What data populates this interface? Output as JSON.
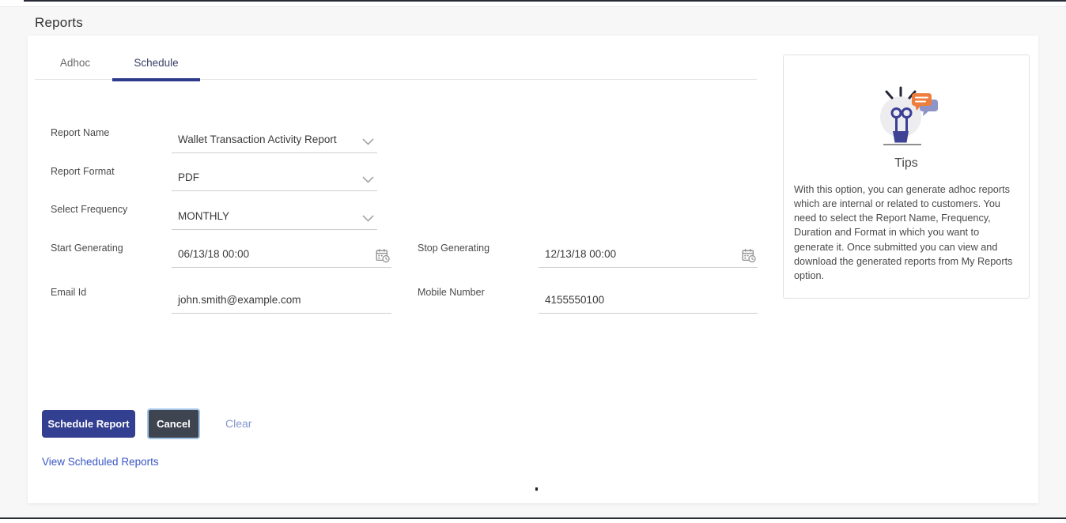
{
  "page": {
    "title": "Reports"
  },
  "tabs": [
    {
      "label": "Adhoc",
      "active": false
    },
    {
      "label": "Schedule",
      "active": true
    }
  ],
  "form": {
    "report_name": {
      "label": "Report Name",
      "value": "Wallet Transaction Activity Report"
    },
    "report_format": {
      "label": "Report Format",
      "value": "PDF"
    },
    "select_frequency": {
      "label": "Select Frequency",
      "value": "MONTHLY"
    },
    "start_generating": {
      "label": "Start Generating",
      "value": "06/13/18 00:00"
    },
    "stop_generating": {
      "label": "Stop Generating",
      "value": "12/13/18 00:00"
    },
    "email_id": {
      "label": "Email Id",
      "value": "john.smith@example.com"
    },
    "mobile_number": {
      "label": "Mobile Number",
      "value": "4155550100"
    }
  },
  "actions": {
    "schedule_report": "Schedule Report",
    "cancel": "Cancel",
    "clear": "Clear",
    "view_scheduled_reports": "View Scheduled Reports"
  },
  "tips": {
    "title": "Tips",
    "body": "With this option, you can generate adhoc reports which are internal or related to customers. You need to select the Report Name, Frequency, Duration and Format in which you want to generate it. Once submitted you can view and download the generated reports from My Reports option."
  },
  "icons": {
    "dropdown": "chevron-down-icon",
    "datetime": "calendar-clock-icon",
    "tips": "lightbulb-chat-icon"
  },
  "colors": {
    "primary_button": "#333f90",
    "cancel_button": "#3e4450",
    "cancel_focus_ring": "#a5c6e8",
    "tab_underline": "#2e3a8c",
    "link_view": "#3a57c5",
    "link_clear": "#8496cc",
    "page_background": "#f7f7f8",
    "field_underline": "#cfcfcf",
    "tips_bubble_orange": "#ee7e3d",
    "tips_bubble_purple": "#8e93c8"
  }
}
